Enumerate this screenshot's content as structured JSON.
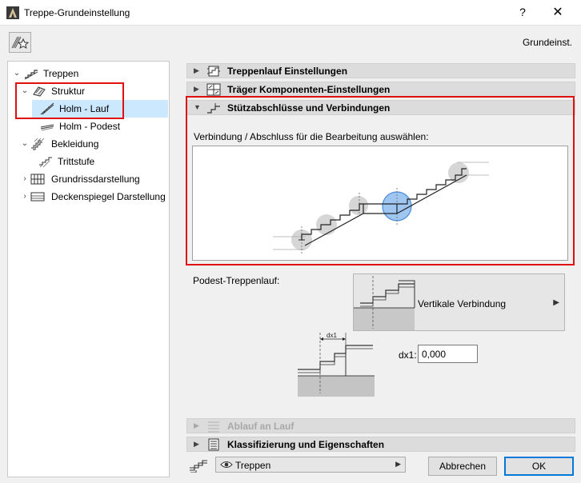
{
  "window": {
    "title": "Treppe-Grundeinstellung",
    "help_label": "?",
    "close_label": "✕",
    "preset_label": "Grundeinst."
  },
  "tree": {
    "items": [
      {
        "label": "Treppen",
        "expanded": true,
        "icon": "stair-icon"
      },
      {
        "label": "Struktur",
        "expanded": true,
        "icon": "structure-icon"
      },
      {
        "label": "Holm - Lauf",
        "selected": true,
        "icon": "stringer-flight-icon"
      },
      {
        "label": "Holm - Podest",
        "icon": "stringer-landing-icon"
      },
      {
        "label": "Bekleidung",
        "expanded": true,
        "icon": "finish-icon"
      },
      {
        "label": "Trittstufe",
        "icon": "tread-icon"
      },
      {
        "label": "Grundrissdarstellung",
        "expanded": false,
        "icon": "floorplan-icon"
      },
      {
        "label": "Deckenspiegel Darstellung",
        "expanded": false,
        "icon": "ceiling-plan-icon"
      }
    ]
  },
  "sections": [
    {
      "label": "Treppenlauf Einstellungen",
      "expanded": false,
      "enabled": true
    },
    {
      "label": "Träger Komponenten-Einstellungen",
      "expanded": false,
      "enabled": true
    },
    {
      "label": "Stützabschlüsse und Verbindungen",
      "expanded": true,
      "enabled": true
    },
    {
      "label": "Ablauf an Lauf",
      "expanded": false,
      "enabled": false
    },
    {
      "label": "Klassifizierung und Eigenschaften",
      "expanded": false,
      "enabled": true
    }
  ],
  "connections": {
    "prompt": "Verbindung / Abschluss für die Bearbeitung auswählen:",
    "podest_label": "Podest-Treppenlauf:",
    "connection_type": "Vertikale Verbindung",
    "dx_label": "dx1:",
    "dx_value": "0,000",
    "diagram_dim_label": "dx1"
  },
  "footer": {
    "view_label": "Treppen",
    "cancel_label": "Abbrechen",
    "ok_label": "OK"
  },
  "colors": {
    "highlight_red": "#e01010",
    "selection_blue": "#cce8ff",
    "ok_border": "#0078d7"
  }
}
